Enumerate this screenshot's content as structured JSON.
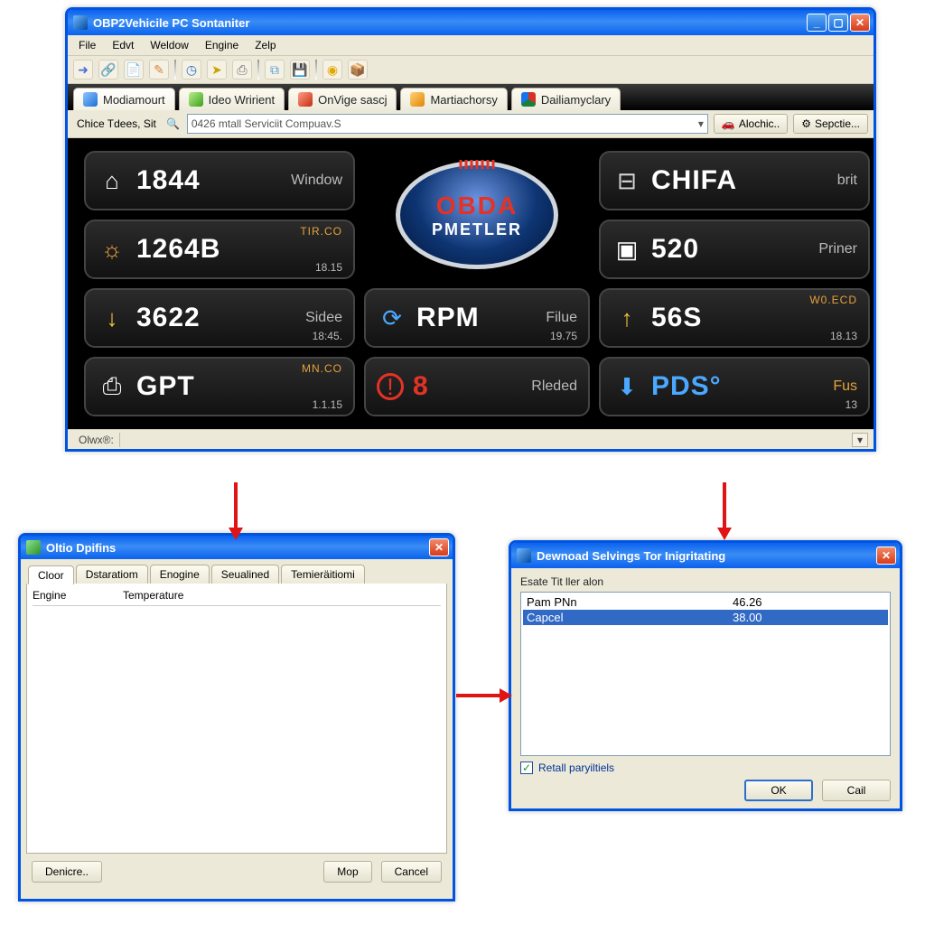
{
  "main": {
    "title": "OBP2Vehicile PC Sontaniter",
    "menus": [
      "File",
      "Edvt",
      "Weldow",
      "Engine",
      "Zelp"
    ],
    "tabs": [
      {
        "label": "Modiamourt",
        "icon": "c-blue"
      },
      {
        "label": "Ideo Wririent",
        "icon": "c-green"
      },
      {
        "label": "OnVige sascj",
        "icon": "c-red"
      },
      {
        "label": "Martiachorsy",
        "icon": "c-org"
      },
      {
        "label": "Dailiamyclary",
        "icon": "c-chr"
      }
    ],
    "locbar": {
      "left_label": "Chice Tdees, Sit",
      "combo_text": "0426 mtall Serviciit Compuav.S",
      "btn1": "Alochic..",
      "btn2": "Sepctie..."
    },
    "logo": {
      "line1": "OBDA",
      "line2": "PMETLER"
    },
    "gauges": {
      "g1": {
        "value": "1844",
        "unit": "Window",
        "icon": "⌂",
        "icon_name": "window-icon"
      },
      "g2": {
        "value": "1264B",
        "tag": "TIR.CO",
        "sub": "18.15",
        "icon": "☼",
        "icon_name": "sun-icon",
        "tag_color": "#e7a13a"
      },
      "g3": {
        "value": "3622",
        "unit": "Sidee",
        "sub": "18:45.",
        "icon": "↓",
        "icon_name": "down-arrow-icon",
        "icon_color": "#f2c23d"
      },
      "g4": {
        "value": "GPT",
        "tag": "MN.CO",
        "sub": "1.1.15",
        "icon": "⎙",
        "icon_name": "engine-icon"
      },
      "g5": {
        "value": "RPM",
        "unit": "Filue",
        "sub": "19.75",
        "icon": "⟳",
        "icon_name": "rpm-icon",
        "icon_color": "#4aa8ff"
      },
      "g6": {
        "value": "8",
        "unit": "Rleded",
        "icon": "⊘",
        "icon_name": "alert-icon",
        "val_color": "#e53225",
        "icon_color": "#e53225"
      },
      "g7": {
        "value": "CHIFA",
        "unit": "brit",
        "icon": "⊟",
        "icon_name": "vehicle-icon",
        "icon_color": "#4aa8ff"
      },
      "g8": {
        "value": "520",
        "unit": "Priner",
        "icon": "▣",
        "icon_name": "printer-icon"
      },
      "g9": {
        "value": "56S",
        "tag": "W0.ECD",
        "sub": "18.13",
        "icon": "↑",
        "icon_name": "up-arrow-icon",
        "icon_color": "#f2c23d",
        "tag_color": "#e7a13a"
      },
      "g10": {
        "value": "PDS°",
        "unit": "Fus",
        "sub": "13",
        "icon": "⬇",
        "icon_name": "download-icon",
        "icon_color": "#4aa8ff",
        "unit_color": "#e7a13a",
        "val_color": "#4aa8ff"
      }
    },
    "status": {
      "label": "Olwx®:"
    }
  },
  "options": {
    "title": "Oltio Dpifins",
    "tabs": [
      "Cloor",
      "Dstaratiom",
      "Enogine",
      "Seualined",
      "Temieräitiomi"
    ],
    "columns": [
      "Engine",
      "Temperature"
    ],
    "buttons": [
      "Denicre..",
      "Mop",
      "Cancel"
    ]
  },
  "settings": {
    "title": "Dewnoad Selvings Tor Inigritating",
    "instruction": "Esate Tit ller alon",
    "rows": [
      {
        "name": "Pam PNn",
        "value": "46.26"
      },
      {
        "name": "Capcel",
        "value": "38.00"
      }
    ],
    "checkbox": "Retall paryiltiels",
    "ok": "OK",
    "cancel": "Cail"
  }
}
